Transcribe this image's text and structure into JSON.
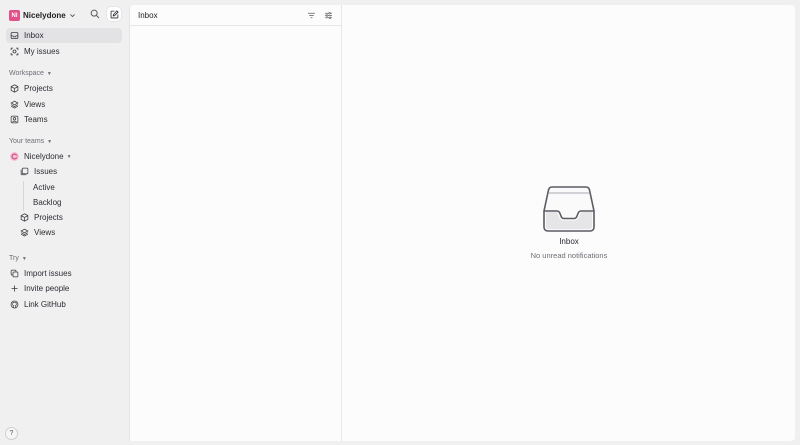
{
  "workspace": {
    "initials": "NI",
    "name": "Nicelydone",
    "avatar_color": "#e0508a",
    "header_icons": [
      "search-icon",
      "compose-icon"
    ]
  },
  "sidebar": {
    "top_items": [
      {
        "label": "Inbox",
        "icon": "inbox-icon",
        "active": true
      },
      {
        "label": "My issues",
        "icon": "target-icon",
        "active": false
      }
    ],
    "workspace_section": {
      "label": "Workspace",
      "items": [
        {
          "label": "Projects",
          "icon": "cube-icon"
        },
        {
          "label": "Views",
          "icon": "layers-icon"
        },
        {
          "label": "Teams",
          "icon": "team-icon"
        }
      ]
    },
    "teams_section": {
      "label": "Your teams",
      "team": {
        "name": "Nicelydone",
        "icon": "team-avatar-icon"
      },
      "items": [
        {
          "label": "Issues",
          "icon": "issues-icon"
        },
        {
          "label": "Active",
          "icon": ""
        },
        {
          "label": "Backlog",
          "icon": ""
        },
        {
          "label": "Projects",
          "icon": "cube-icon"
        },
        {
          "label": "Views",
          "icon": "layers-icon"
        }
      ]
    },
    "try_section": {
      "label": "Try",
      "items": [
        {
          "label": "Import issues",
          "icon": "import-icon"
        },
        {
          "label": "Invite people",
          "icon": "plus-icon"
        },
        {
          "label": "Link GitHub",
          "icon": "github-icon"
        }
      ]
    },
    "help_label": "?"
  },
  "list_panel": {
    "title": "Inbox",
    "icons": [
      "filter-icon",
      "display-options-icon"
    ]
  },
  "detail_panel": {
    "empty_title": "Inbox",
    "empty_subtitle": "No unread notifications"
  }
}
